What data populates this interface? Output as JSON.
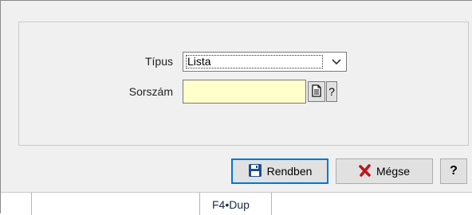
{
  "form": {
    "tipus_label": "Típus",
    "tipus_value": "Lista",
    "sorszam_label": "Sorszám",
    "sorszam_value": "",
    "help_small_label": "?"
  },
  "buttons": {
    "ok_label": "Rendben",
    "cancel_label": "Mégse",
    "help_label": "?"
  },
  "statusbar": {
    "shortcut": "F4•Dup"
  },
  "icons": {
    "save": "floppy-icon",
    "cancel": "red-x-icon",
    "document": "document-icon",
    "dropdown": "chevron-down-icon"
  },
  "colors": {
    "input_bg": "#ffffcc",
    "accent": "#0078d7",
    "cancel_x": "#c0141c",
    "floppy": "#1e4e8c"
  }
}
